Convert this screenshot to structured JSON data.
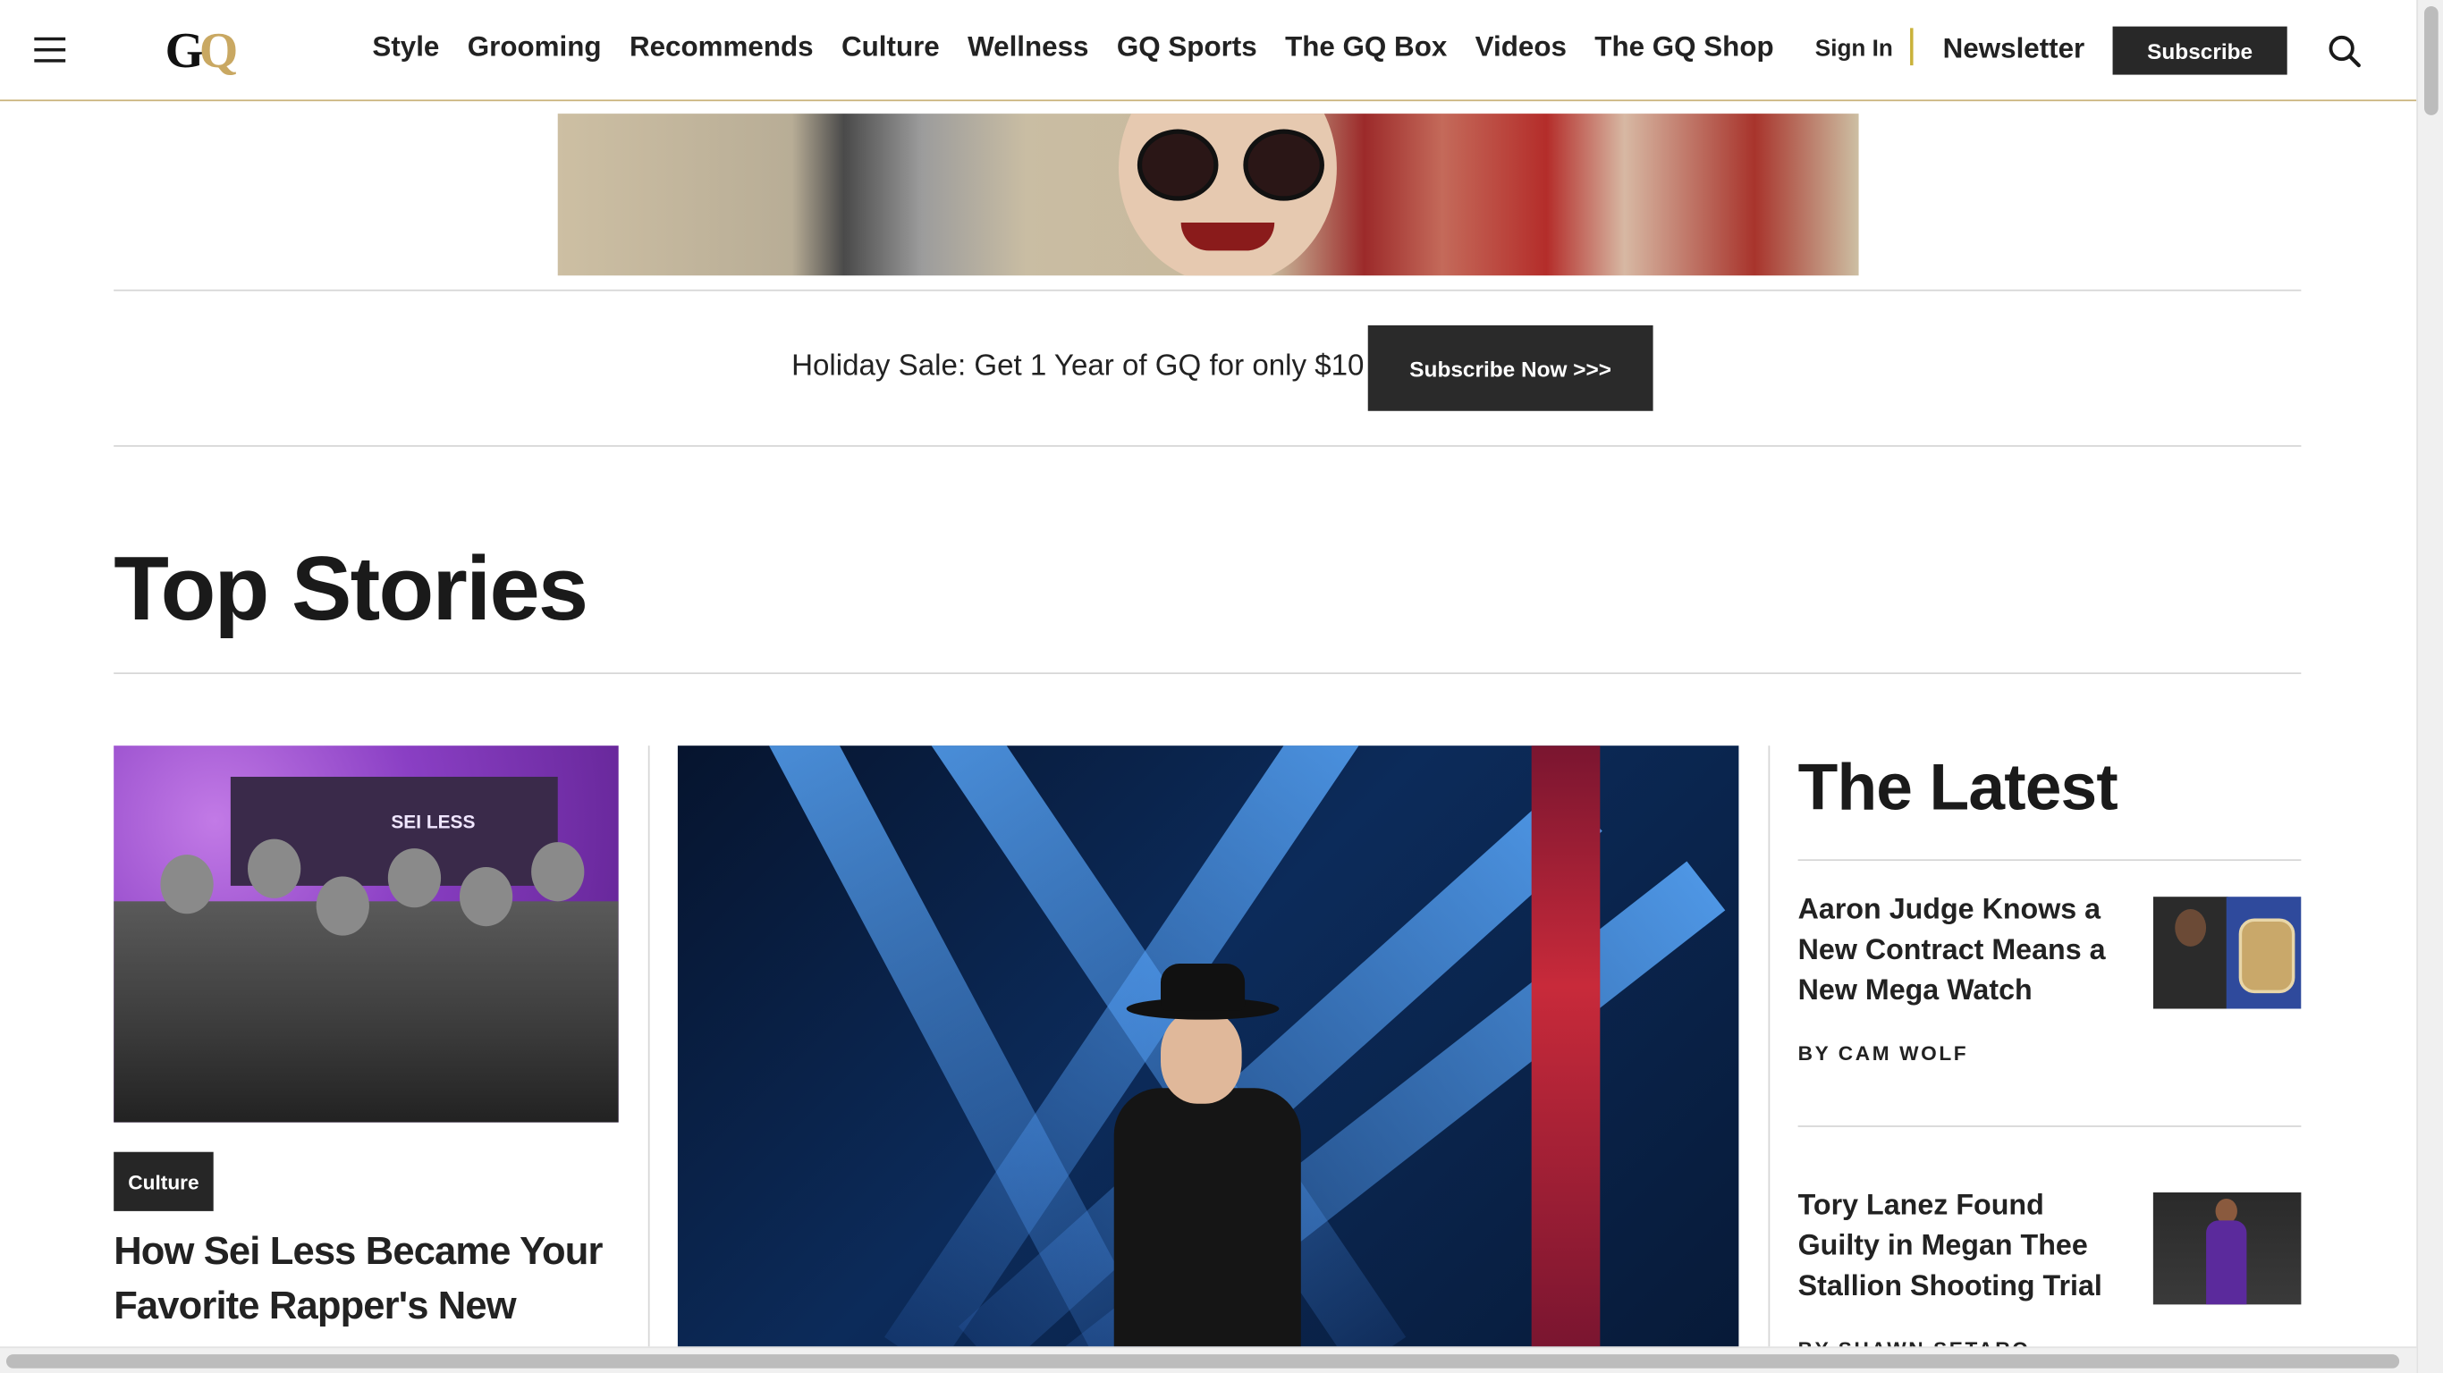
{
  "header": {
    "logo_text": "GQ",
    "nav": [
      "Style",
      "Grooming",
      "Recommends",
      "Culture",
      "Wellness",
      "GQ Sports",
      "The GQ Box",
      "Videos",
      "The GQ Shop"
    ],
    "sign_in": "Sign In",
    "newsletter": "Newsletter",
    "subscribe": "Subscribe"
  },
  "promo": {
    "text": "Holiday Sale: Get 1 Year of GQ for only $10",
    "button": "Subscribe Now >>>"
  },
  "section_title": "Top Stories",
  "story_left": {
    "tag": "Culture",
    "title": "How Sei Less Became Your Favorite Rapper's New",
    "image_sign": "SEI LESS"
  },
  "latest": {
    "title": "The Latest",
    "items": [
      {
        "title": "Aaron Judge Knows a New Contract Means a New Mega Watch",
        "byline": "BY CAM WOLF"
      },
      {
        "title": "Tory Lanez Found Guilty in Megan Thee Stallion Shooting Trial",
        "byline": "BY SHAWN SETARO"
      }
    ]
  },
  "colors": {
    "gold": "#c9a862",
    "dark_button": "#282828",
    "header_border": "#c9b27a"
  },
  "icons": [
    "menu-icon",
    "search-icon"
  ]
}
